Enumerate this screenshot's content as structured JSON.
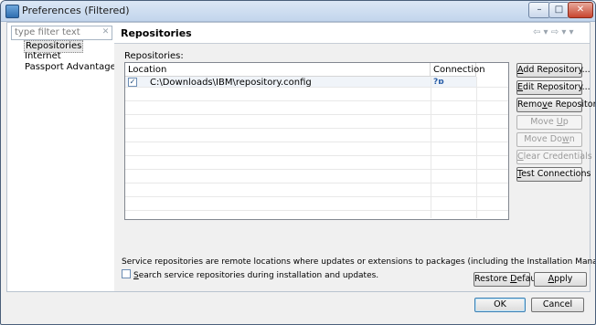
{
  "window": {
    "title": "Preferences (Filtered)",
    "min_glyph": "–",
    "max_glyph": "□",
    "close_glyph": "✕"
  },
  "filter": {
    "placeholder": "type filter text",
    "clear_glyph": "✕"
  },
  "nav": {
    "items": [
      {
        "label": "Repositories",
        "selected": true
      },
      {
        "label": "Internet",
        "selected": false
      },
      {
        "label": "Passport Advantage",
        "selected": false
      }
    ]
  },
  "page": {
    "title": "Repositories",
    "nav_arrows": "⇦ ▾ ⇨ ▾ ▾"
  },
  "repositories": {
    "label": "Repositories:",
    "columns": {
      "location": "Location",
      "connection": "Connection"
    },
    "rows": [
      {
        "location": "C:\\Downloads\\IBM\\repository.config",
        "checked": true,
        "checkmark": "✓",
        "connection_glyph": "?ɒ"
      }
    ]
  },
  "buttons": {
    "add_pre": "",
    "add_u": "A",
    "add_post": "dd Repository...",
    "edit_pre": "",
    "edit_u": "E",
    "edit_post": "dit Repository...",
    "remove_pre": "Remo",
    "remove_u": "v",
    "remove_post": "e Repository",
    "moveup_pre": "Move ",
    "moveup_u": "U",
    "moveup_post": "p",
    "movedown_pre": "Move Do",
    "movedown_u": "w",
    "movedown_post": "n",
    "clear_pre": "",
    "clear_u": "C",
    "clear_post": "lear Credentials",
    "test_pre": "",
    "test_u": "T",
    "test_post": "est Connections",
    "restore_pre": "Restore ",
    "restore_u": "D",
    "restore_post": "efaults",
    "apply_pre": "",
    "apply_u": "A",
    "apply_post": "pply",
    "ok": "OK",
    "cancel": "Cancel"
  },
  "description": "Service repositories are remote locations where updates or extensions to packages (including the Installation Manager itself) are stored.",
  "search_option": {
    "pre": "",
    "u": "S",
    "post": "earch service repositories during installation and updates.",
    "checked": false
  }
}
